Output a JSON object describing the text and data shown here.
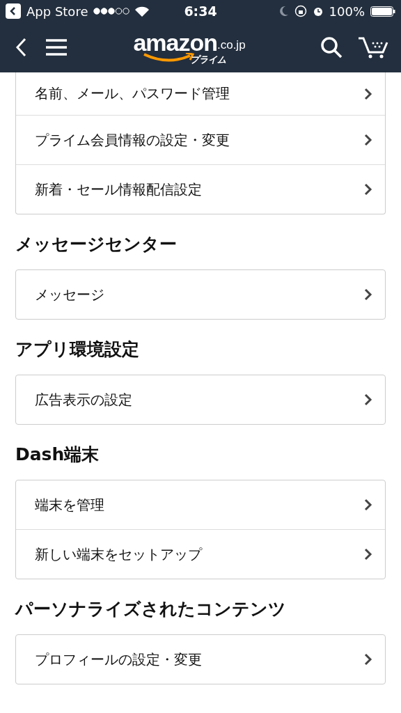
{
  "status_bar": {
    "back_app": "App Store",
    "time": "6:34",
    "battery": "100%"
  },
  "header": {
    "logo": {
      "wordmark": "amazon",
      "domain": ".co.jp",
      "tagline": "プライム"
    }
  },
  "sections": [
    {
      "items": [
        "名前、メール、パスワード管理",
        "プライム会員情報の設定・変更",
        "新着・セール情報配信設定"
      ]
    },
    {
      "title": "メッセージセンター",
      "items": [
        "メッセージ"
      ]
    },
    {
      "title": "アプリ環境設定",
      "items": [
        "広告表示の設定"
      ]
    },
    {
      "title": "Dash端末",
      "items": [
        "端末を管理",
        "新しい端末をセットアップ"
      ]
    },
    {
      "title": "パーソナライズされたコンテンツ",
      "items": [
        "プロフィールの設定・変更"
      ]
    }
  ]
}
